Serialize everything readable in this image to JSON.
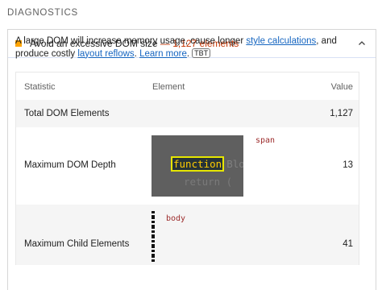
{
  "section": {
    "title": "DIAGNOSTICS"
  },
  "audit": {
    "title": "Avoid an excessive DOM size",
    "separator": " — ",
    "display_value": "1,127 elements",
    "status_color": "#ffa400",
    "expanded_icon": "chevron-up-icon",
    "description": {
      "text_before": "A large DOM will increase memory usage, cause longer ",
      "link1": "style calculations",
      "text_middle": ", and produce costly ",
      "link2": "layout reflows",
      "text_after": ". ",
      "learn_more": "Learn more",
      "period": ".",
      "badge": "TBT"
    }
  },
  "table": {
    "headers": {
      "statistic": "Statistic",
      "element": "Element",
      "value": "Value"
    },
    "rows": [
      {
        "statistic": "Total DOM Elements",
        "element": "",
        "value": "1,127"
      },
      {
        "statistic": "Maximum DOM Depth",
        "element_tag": "span",
        "snippet_keyword": "function",
        "snippet_faded": "Blo",
        "snippet_line2": "return (",
        "value": "13"
      },
      {
        "statistic": "Maximum Child Elements",
        "element_tag": "body",
        "value": "41"
      }
    ]
  }
}
